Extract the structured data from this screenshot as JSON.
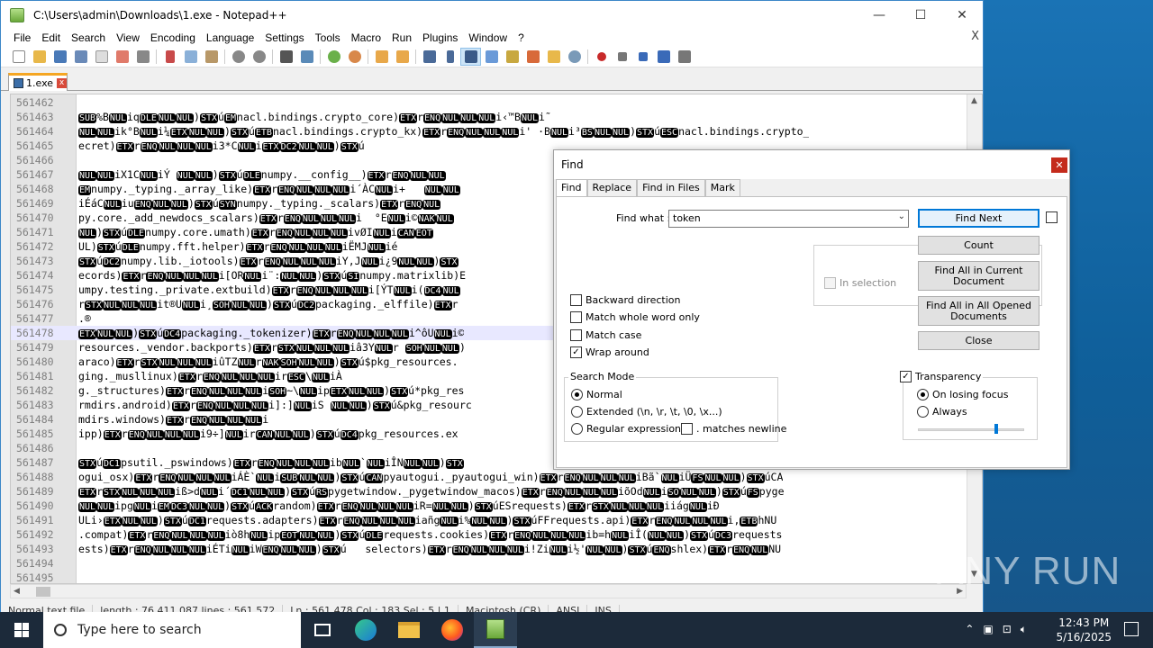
{
  "window": {
    "title": "C:\\Users\\admin\\Downloads\\1.exe - Notepad++",
    "controls": {
      "minimize": "—",
      "maximize": "☐",
      "close": "✕"
    }
  },
  "menu": {
    "items": [
      "File",
      "Edit",
      "Search",
      "View",
      "Encoding",
      "Language",
      "Settings",
      "Tools",
      "Macro",
      "Run",
      "Plugins",
      "Window",
      "?"
    ],
    "close_glyph": "X"
  },
  "tab": {
    "label": "1.exe",
    "close": "x"
  },
  "editor": {
    "lines": [
      {
        "n": "561462",
        "t": ""
      },
      {
        "n": "561463",
        "t": "SUB%BNULiqDLENULNUL)STXúEMnacl.bindings.crypto_core)ETXrENQNULNULNULi‹™BNULi˜"
      },
      {
        "n": "561464",
        "t": "NULNULik°BNULi¼ETXNULNUL)STXúETBnacl.bindings.crypto_kx)ETXrENQNULNULNULi' ·BNULi³BSNULNUL)STXúESCnacl.bindings.crypto_"
      },
      {
        "n": "561465",
        "t": "ecret)ETXrENQNULNULNULi3*CNULiETXDC2NULNUL)STXú"
      },
      {
        "n": "561466",
        "t": ""
      },
      {
        "n": "561467",
        "t": "NULNULiX1CNULiÝ NULNUL)STXúDLEnumpy.__config__)ETXrENQNULNUL"
      },
      {
        "n": "561468",
        "t": "EMnumpy._typing._array_like)ETXrENQNULNULNULi´ÀCNULi+   NULNUL"
      },
      {
        "n": "561469",
        "t": "iÉáCNULiuENQNULNUL)STXúSYNnumpy._typing._scalars)ETXrENQNUL"
      },
      {
        "n": "561470",
        "t": "py.core._add_newdocs_scalars)ETXrENQNULNULNULi  °ENULi©NAKNUL"
      },
      {
        "n": "561471",
        "t": "NUL)STXúDLEnumpy.core.umath)ETXrENQNULNULNULivØINULiCANEOT"
      },
      {
        "n": "561472",
        "t": "UL)STXúDLEnumpy.fft.helper)ETXrENQNULNULNULiËMJNULié"
      },
      {
        "n": "561473",
        "t": "STXúDC2numpy.lib._iotools)ETXrENQNULNULNULiY,JNULi¿9NULNUL)STX"
      },
      {
        "n": "561474",
        "t": "ecords)ETXrENQNULNULNULi[ORNULi¨:NULNUL)STXúSInumpy.matrixlib)E"
      },
      {
        "n": "561475",
        "t": "umpy.testing._private.extbuild)ETXrENQNULNULNULi[ÝTNULi(DC4NUL"
      },
      {
        "n": "561476",
        "t": "rSTXNULNULNULit®UNULi¸SOHNULNUL)STXúDC2packaging._elffile)ETXr"
      },
      {
        "n": "561477",
        "t": ".®"
      },
      {
        "n": "561478",
        "t": "ETXNULNUL)STXúDC4packaging._tokenizer)ETXrENQNULNULNULi^ôUNULi©"
      },
      {
        "n": "561479",
        "t": "resources._vendor.backports)ETXrSTXNULNULNULiâ3YNULr SOHNULNUL)"
      },
      {
        "n": "561480",
        "t": "araco)ETXrSTXNULNULNULiûTZNULrNAKSOHNULNUL)STXú$pkg_resources."
      },
      {
        "n": "561481",
        "t": "ging._musllinux)ETXrENQNULNULNULirESC\\NULiÀ"
      },
      {
        "n": "561482",
        "t": "g._structures)ETXrENQNULNULNULiSOH~\\NULipETXNULNUL)STXú*pkg_res"
      },
      {
        "n": "561483",
        "t": "rmdirs.android)ETXrENQNULNULNULi]:]NULiS NULNUL)STXú&pkg_resourc"
      },
      {
        "n": "561484",
        "t": "mdirs.windows)ETXrENQNULNULNULi"
      },
      {
        "n": "561485",
        "t": "ipp)ETXrENQNULNULNULi9÷]NULirCANNULNUL)STXúDC4pkg_resources.ex"
      },
      {
        "n": "561486",
        "t": ""
      },
      {
        "n": "561487",
        "t": "STXúDC1psutil._pswindows)ETXrENQNULNULNULibNUL`NULiÎNNULNUL)STX"
      },
      {
        "n": "561488",
        "t": "ogui_osx)ETXrENQNULNULNULiÁÈ`NULiSUBNULNUL)STXúCANpyautogui._pyautogui_win)ETXrENQNULNULNULiBã`NULiÜFSNULNUL)STXúCA"
      },
      {
        "n": "561489",
        "t": "ETXrSTXNULNULNULiß>dNULi´DC1NULNUL)STXúRSpygetwindow._pygetwindow_macos)ETXrENQNULNULNULiõOdNULiSONULNUL)STXúFSpyge"
      },
      {
        "n": "561490",
        "t": "NULNULipgNULiEMDC3NULNUL)STXúACKrandom)ETXrENQNULNULNULiR=NULNUL)STXúESrequests)ETXrSTXNULNULNULiiágNULiÐ"
      },
      {
        "n": "561491",
        "t": "ULi›ETXNULNUL)STXúDC1requests.adapters)ETXrENQNULNULNULiañgNULi%NULNUL)STXúFFrequests.api)ETXrENQNULNULNULi,ETBhNU"
      },
      {
        "n": "561492",
        "t": ".compat)ETXrENQNULNULNULiò8hNULipEOTNULNUL)STXúDLErequests.cookies)ETXrENQNULNULNULib=hNULiÎ(NULNUL)STXúDC3requests"
      },
      {
        "n": "561493",
        "t": "ests)ETXrENQNULNULNULiÉTiNULiWENQNULNUL)STXú   selectors)ETXrENQNULNULNULi!ZiNULi½'NULNUL)STXúENQshlex)ETXrENQNULNU"
      },
      {
        "n": "561494",
        "t": ""
      },
      {
        "n": "561495",
        "t": ""
      }
    ]
  },
  "status": {
    "cells": [
      "Normal text file",
      "length : 76,411,087   lines : 561,572",
      "Ln : 561,478   Col : 183   Sel : 5 | 1",
      "Macintosh (CR)",
      "ANSI",
      "INS"
    ]
  },
  "find_dialog": {
    "title": "Find",
    "close": "✕",
    "tabs": [
      "Find",
      "Replace",
      "Find in Files",
      "Mark"
    ],
    "find_what_label": "Find what :",
    "find_what_value": "token",
    "buttons": {
      "find_next": "Find Next",
      "count": "Count",
      "find_all_current": "Find All in Current Document",
      "find_all_opened": "Find All in All Opened Documents",
      "close": "Close"
    },
    "in_selection": "In selection",
    "options": {
      "backward": "Backward direction",
      "whole_word": "Match whole word only",
      "match_case": "Match case",
      "wrap_around": "Wrap around"
    },
    "search_mode": {
      "title": "Search Mode",
      "normal": "Normal",
      "extended": "Extended (\\n, \\r, \\t, \\0, \\x...)",
      "regex": "Regular expression",
      "matches_newline": ". matches newline"
    },
    "transparency": {
      "title": "Transparency",
      "on_losing_focus": "On losing focus",
      "always": "Always",
      "level": 0.72
    }
  },
  "taskbar": {
    "search_placeholder": "Type here to search",
    "time": "12:43 PM",
    "date": "5/16/2025"
  },
  "watermark": "ANY RUN"
}
